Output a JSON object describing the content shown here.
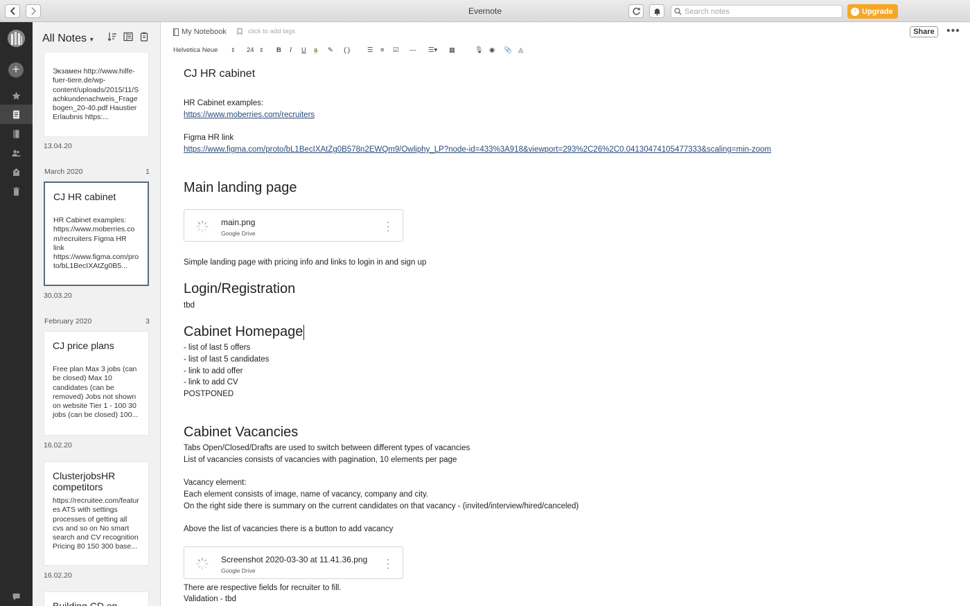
{
  "window": {
    "title": "Evernote"
  },
  "search": {
    "placeholder": "Search notes"
  },
  "upgrade": {
    "label": "Upgrade"
  },
  "notelist": {
    "title": "All Notes",
    "top_card": {
      "snippet": "Экзамен http://www.hilfe-fuer-tiere.de/wp-content/uploads/2015/11/Sachkundenachweis_Fragebogen_20-40.pdf Haustier Erlaubnis https:...",
      "date": "13.04.20"
    },
    "groups": [
      {
        "label": "March 2020",
        "count": "1",
        "notes": [
          {
            "title": "CJ HR cabinet",
            "snippet": "HR Cabinet examples: https://www.moberries.com/recruiters Figma HR link https://www.figma.com/proto/bL1BecIXAtZg0B5...",
            "date": "30.03.20"
          }
        ]
      },
      {
        "label": "February 2020",
        "count": "3",
        "notes": [
          {
            "title": "CJ price plans",
            "snippet": "Free plan Max 3 jobs (can be closed) Max 10 candidates (can be removed) Jobs not shown on website Tier 1 - 100 30 jobs (can be closed) 100...",
            "date": "16.02.20"
          },
          {
            "title": "ClusterjobsHR competitors",
            "snippet": "https://recruitee.com/features ATS with settings processes of getting all cvs and so on No smart search and CV recognition Pricing 80 150 300 base...",
            "date": "16.02.20"
          },
          {
            "title": "Building CD on"
          }
        ]
      }
    ]
  },
  "editor": {
    "notebook": "My Notebook",
    "tags_placeholder": "click to add tags",
    "share_label": "Share",
    "more_label": "•••",
    "toolbar": {
      "font": "Helvetica Neue",
      "size": "24"
    },
    "note": {
      "title": "CJ HR cabinet",
      "hr_examples_label": "HR Cabinet examples:",
      "hr_examples_link": "https://www.moberries.com/recruiters",
      "figma_label": "Figma HR link",
      "figma_link": "https://www.figma.com/proto/bL1BecIXAtZg0B578n2EWQm9/Owliphy_LP?node-id=433%3A918&viewport=293%2C26%2C0.04130474105477333&scaling=min-zoom",
      "main_heading": "Main landing page",
      "attachment1": {
        "name": "main.png",
        "source": "Google Drive"
      },
      "main_desc": "Simple landing page with pricing info and links to login in and sign up",
      "login_heading": "Login/Registration",
      "login_text": "tbd",
      "home_heading": "Cabinet Homepage",
      "home_items": [
        "- list of last 5 offers",
        "- list of last 5 candidates",
        "- link to add offer",
        "- link to add CV",
        "POSTPONED"
      ],
      "vac_heading": "Cabinet Vacancies",
      "vac_lines": [
        "Tabs Open/Closed/Drafts are used to switch between different types of vacancies",
        "List of vacancies consists of vacancies with pagination, 10 elements per page"
      ],
      "vac_element_label": "Vacancy element:",
      "vac_element_lines": [
        "Each element consists of image, name of vacancy, company and city.",
        "On the right side there is summary on the current candidates on that vacancy - (invited/interview/hired/canceled)"
      ],
      "vac_add_line": "Above the list of vacancies there is a button to add vacancy",
      "attachment2": {
        "name": "Screenshot 2020-03-30 at 11.41.36.png",
        "source": "Google Drive"
      },
      "fields_line": "There are respective fields for recruiter to fill.",
      "validation_line": "Validation - tbd"
    }
  },
  "colors": {
    "accent": "#f6a726",
    "rail": "#2a2a2a",
    "link": "#2a4a7a"
  }
}
